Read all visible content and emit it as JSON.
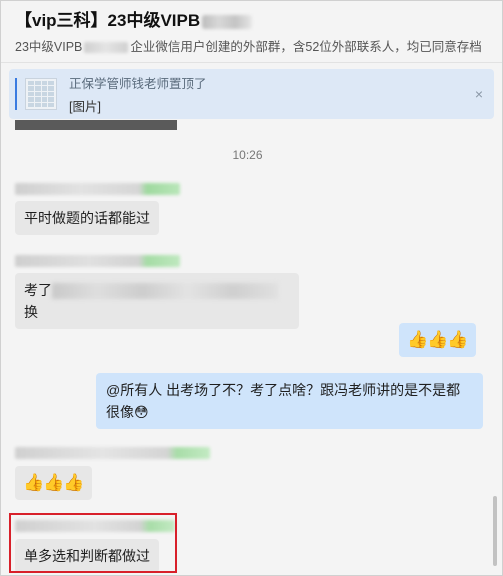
{
  "header": {
    "title": "【vip三科】23中级VIPB",
    "subtitle_prefix": "23中级VIPB",
    "subtitle_suffix": "企业微信用户创建的外部群，含52位外部联系人，均已同意存档"
  },
  "pinned": {
    "notice": "正保学管师钱老师置顶了",
    "content": "[图片]",
    "close_icon": "×"
  },
  "chat": {
    "timestamp": "10:26",
    "messages": [
      {
        "side": "left",
        "text": "平时做题的话都能过"
      },
      {
        "side": "left",
        "text_start": "考了",
        "text_end": "换"
      },
      {
        "side": "right",
        "text": "👍👍👍"
      },
      {
        "side": "right",
        "text": "@所有人  出考场了不？考了点啥？跟冯老师讲的是不是都很像😳"
      },
      {
        "side": "left",
        "text": "👍👍👍"
      },
      {
        "side": "left",
        "text": "单多选和判断都做过"
      }
    ]
  },
  "colors": {
    "accent": "#3a7be0",
    "highlight": "#d8202a",
    "bubble_self": "#cfe4fb",
    "bubble_other": "#e7e7e7"
  }
}
